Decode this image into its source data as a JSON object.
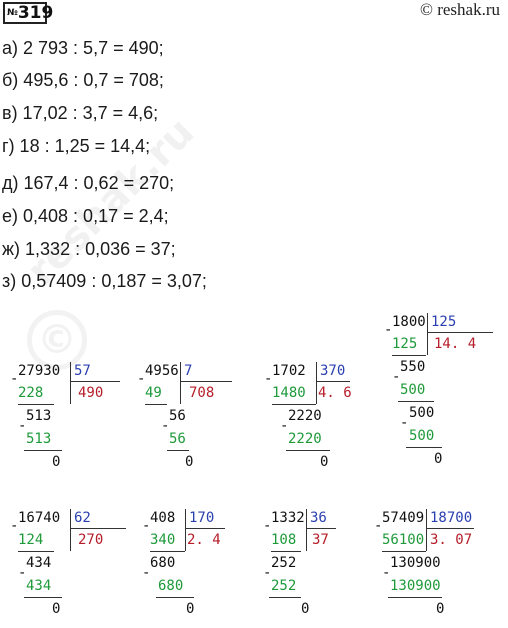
{
  "header": {
    "no": "№",
    "num": "319",
    "site": "© reshak.ru"
  },
  "equations": [
    "а) 2 793 : 5,7 = 490;",
    "б) 495,6 : 0,7 = 708;",
    "в) 17,02 : 3,7 = 4,6;",
    "г) 18 : 1,25 = 14,4;",
    "д) 167,4 : 0,62 = 270;",
    "е) 0,408 : 0,17 = 2,4;",
    "ж) 1,332 : 0,036 = 37;",
    "з) 0,57409 : 0,187 = 3,07;"
  ],
  "watermark": "reshak.ru",
  "divisions": [
    {
      "dividend": "27930",
      "divisor": "57",
      "quotient": "490",
      "steps": [
        "228",
        "513",
        "513"
      ],
      "remainder": "0"
    },
    {
      "dividend": "4956",
      "divisor": "7",
      "quotient": "708",
      "steps": [
        "49",
        "56",
        "56"
      ],
      "remainder": "0"
    },
    {
      "dividend": "1702",
      "divisor": "370",
      "quotient": "4. 6",
      "steps": [
        "1480",
        "2220",
        "2220"
      ],
      "remainder": "0"
    },
    {
      "dividend": "1800",
      "divisor": "125",
      "quotient": "14. 4",
      "steps": [
        "125",
        "550",
        "500",
        "500",
        "500"
      ],
      "remainder": "0"
    },
    {
      "dividend": "16740",
      "divisor": "62",
      "quotient": "270",
      "steps": [
        "124",
        "434",
        "434"
      ],
      "remainder": "0"
    },
    {
      "dividend": "408",
      "divisor": "170",
      "quotient": "2. 4",
      "steps": [
        "340",
        "680",
        "680"
      ],
      "remainder": "0"
    },
    {
      "dividend": "1332",
      "divisor": "36",
      "quotient": "37",
      "steps": [
        "108",
        "252",
        "252"
      ],
      "remainder": "0"
    },
    {
      "dividend": "57409",
      "divisor": "18700",
      "quotient": "3. 07",
      "steps": [
        "56100",
        "130900",
        "130900"
      ],
      "remainder": "0"
    }
  ]
}
